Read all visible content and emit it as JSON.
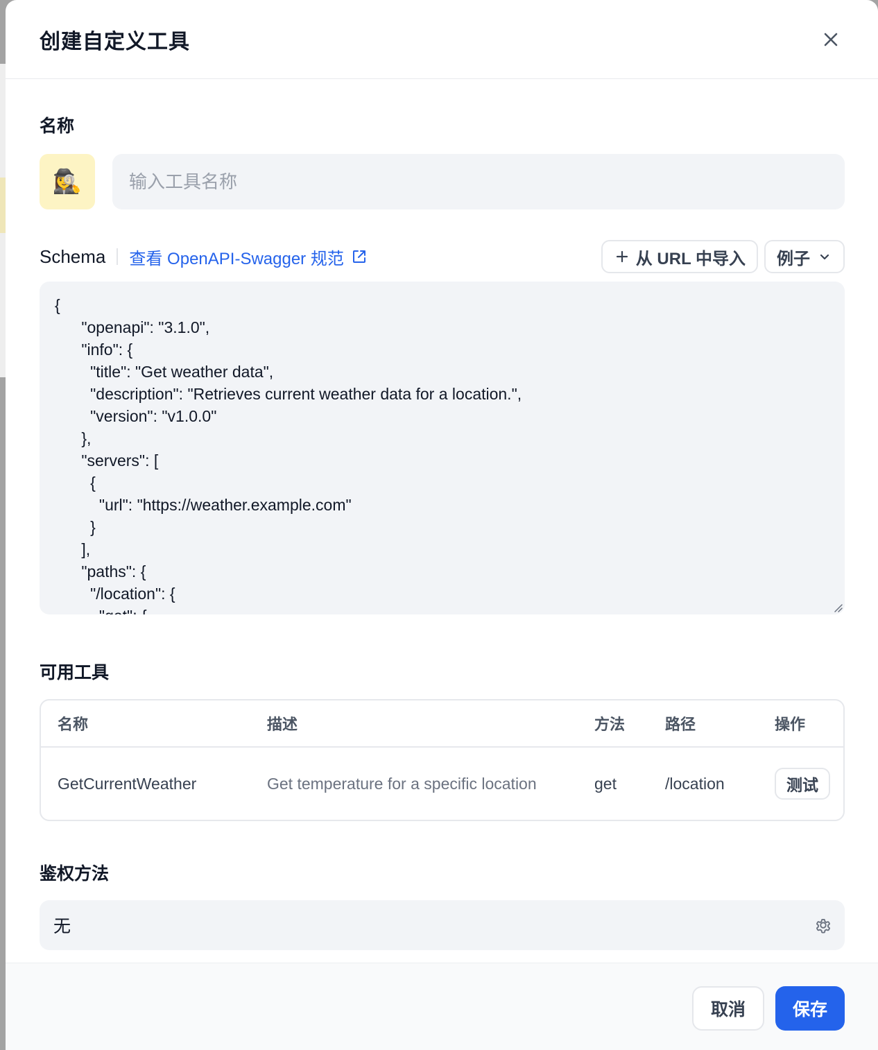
{
  "modal": {
    "title": "创建自定义工具"
  },
  "name_section": {
    "label": "名称",
    "emoji": "🕵️‍♀️",
    "input_placeholder": "输入工具名称",
    "input_value": ""
  },
  "schema_section": {
    "label": "Schema",
    "link_text": "查看 OpenAPI-Swagger 规范",
    "import_button": "从 URL 中导入",
    "example_button": "例子",
    "code": "{\n      \"openapi\": \"3.1.0\",\n      \"info\": {\n        \"title\": \"Get weather data\",\n        \"description\": \"Retrieves current weather data for a location.\",\n        \"version\": \"v1.0.0\"\n      },\n      \"servers\": [\n        {\n          \"url\": \"https://weather.example.com\"\n        }\n      ],\n      \"paths\": {\n        \"/location\": {\n          \"get\": {"
  },
  "tools_section": {
    "label": "可用工具",
    "columns": [
      "名称",
      "描述",
      "方法",
      "路径",
      "操作"
    ],
    "rows": [
      {
        "name": "GetCurrentWeather",
        "description": "Get temperature for a specific location",
        "method": "get",
        "path": "/location",
        "action": "测试"
      }
    ]
  },
  "auth_section": {
    "label": "鉴权方法",
    "value": "无"
  },
  "footer": {
    "cancel": "取消",
    "save": "保存"
  },
  "colors": {
    "primary": "#2463eb",
    "link": "#2563eb",
    "emoji_bg": "#fdf4c4",
    "input_bg": "#f2f4f7"
  }
}
